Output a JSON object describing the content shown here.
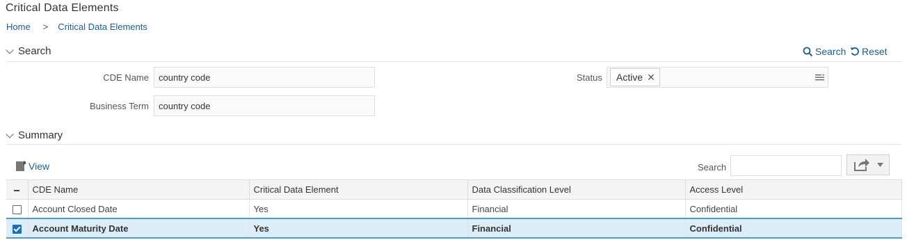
{
  "page": {
    "title": "Critical Data Elements"
  },
  "breadcrumb": {
    "home": "Home",
    "separator": ">",
    "current": "Critical Data Elements"
  },
  "search_section": {
    "title": "Search",
    "search_link": "Search",
    "reset_link": "Reset",
    "cde_name_label": "CDE Name",
    "cde_name_value": "country code",
    "business_term_label": "Business Term",
    "business_term_value": "country code",
    "status_label": "Status",
    "status_chip": "Active"
  },
  "summary_section": {
    "title": "Summary",
    "view_label": "View",
    "search_label": "Search",
    "search_value": ""
  },
  "table": {
    "columns": [
      "CDE Name",
      "Critical Data Element",
      "Data Classification Level",
      "Access Level"
    ],
    "rows": [
      {
        "cde_name": "Account Closed Date",
        "critical": "Yes",
        "classification": "Financial",
        "access": "Confidential",
        "checked": false
      },
      {
        "cde_name": "Account Maturity Date",
        "critical": "Yes",
        "classification": "Financial",
        "access": "Confidential",
        "checked": true
      }
    ]
  },
  "colors": {
    "accent": "#1f5c8b",
    "selection_bg": "#dcedf8",
    "selection_border": "#4a9bd1"
  },
  "icons": [
    "chevron-down-icon",
    "search-icon",
    "reset-icon",
    "close-icon",
    "list-menu-icon",
    "view-document-icon",
    "export-icon",
    "caret-down-icon"
  ]
}
